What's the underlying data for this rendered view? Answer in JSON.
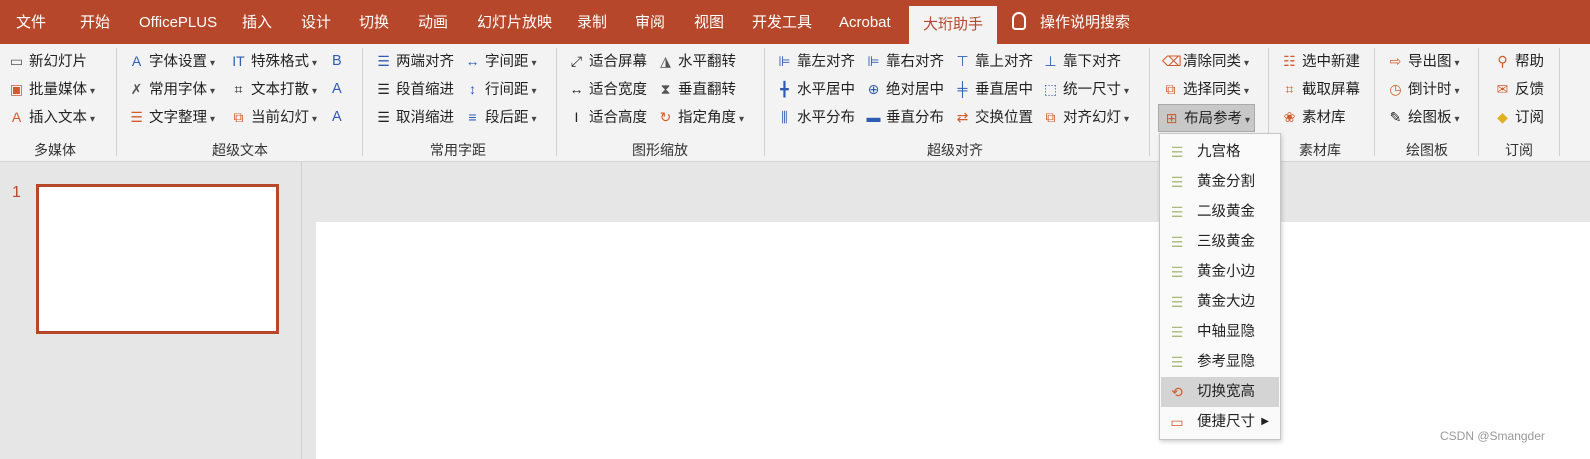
{
  "tabs": [
    "文件",
    "开始",
    "OfficePLUS",
    "插入",
    "设计",
    "切换",
    "动画",
    "幻灯片放映",
    "录制",
    "审阅",
    "视图",
    "开发工具",
    "Acrobat",
    "大珩助手"
  ],
  "search_label": "操作说明搜索",
  "ribbon": {
    "multimedia": {
      "label": "多媒体",
      "items": [
        "新幻灯片",
        "批量媒体",
        "插入文本"
      ]
    },
    "super_text": {
      "label": "超级文本",
      "items": [
        "字体设置",
        "常用字体",
        "文字整理",
        "特殊格式",
        "文本打散",
        "当前幻灯"
      ],
      "icons": [
        "B",
        "A",
        "A"
      ]
    },
    "spacing": {
      "label": "常用字距",
      "items": [
        "两端对齐",
        "段首缩进",
        "取消缩进",
        "字间距",
        "行间距",
        "段后距"
      ]
    },
    "scaling": {
      "label": "图形缩放",
      "items": [
        "适合屏幕",
        "适合宽度",
        "适合高度",
        "水平翻转",
        "垂直翻转",
        "指定角度"
      ]
    },
    "align": {
      "label": "超级对齐",
      "items": [
        "靠左对齐",
        "水平居中",
        "水平分布",
        "靠右对齐",
        "绝对居中",
        "垂直分布",
        "靠上对齐",
        "垂直居中",
        "交换位置",
        "靠下对齐",
        "统一尺寸",
        "对齐幻灯"
      ]
    },
    "misc": {
      "items": [
        "清除同类",
        "选择同类",
        "布局参考"
      ]
    },
    "library": {
      "label": "素材库",
      "items": [
        "选中新建",
        "截取屏幕",
        "素材库"
      ]
    },
    "drawing": {
      "label": "绘图板",
      "items": [
        "导出图",
        "倒计时",
        "绘图板"
      ]
    },
    "subscribe": {
      "label": "订阅",
      "items": [
        "帮助",
        "反馈",
        "订阅"
      ]
    }
  },
  "slide_number": "1",
  "layout_menu": [
    "九宫格",
    "黄金分割",
    "二级黄金",
    "三级黄金",
    "黄金小边",
    "黄金大边",
    "中轴显隐",
    "参考显隐",
    "切换宽高",
    "便捷尺寸"
  ],
  "watermark": "CSDN @Smangder",
  "colors": {
    "accent": "#b7472a",
    "ribbon_bg": "#f3f3f3",
    "workspace_bg": "#e6e6e6"
  }
}
